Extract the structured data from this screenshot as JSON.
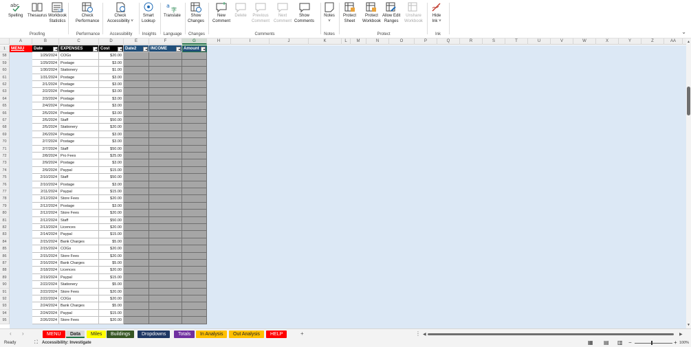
{
  "ribbon": {
    "groups": [
      {
        "label": "Proofing",
        "buttons": [
          {
            "name": "spelling",
            "label": "Spelling",
            "icon": "abc-check-icon"
          },
          {
            "name": "thesaurus",
            "label": "Thesaurus",
            "icon": "book-icon"
          },
          {
            "name": "workbook-statistics",
            "label": "Workbook\nStatistics",
            "icon": "stats-icon"
          }
        ]
      },
      {
        "label": "Performance",
        "buttons": [
          {
            "name": "check-performance",
            "label": "Check\nPerformance",
            "icon": "performance-icon"
          }
        ]
      },
      {
        "label": "Accessibility",
        "buttons": [
          {
            "name": "check-accessibility",
            "label": "Check\nAccessibility ˅",
            "icon": "accessibility-icon"
          }
        ]
      },
      {
        "label": "Insights",
        "buttons": [
          {
            "name": "smart-lookup",
            "label": "Smart\nLookup",
            "icon": "search-icon"
          }
        ]
      },
      {
        "label": "Language",
        "buttons": [
          {
            "name": "translate",
            "label": "Translate",
            "icon": "translate-icon"
          }
        ]
      },
      {
        "label": "Changes",
        "buttons": [
          {
            "name": "show-changes",
            "label": "Show\nChanges",
            "icon": "changes-icon"
          }
        ]
      },
      {
        "label": "Comments",
        "buttons": [
          {
            "name": "new-comment",
            "label": "New\nComment",
            "icon": "comment-icon"
          },
          {
            "name": "delete",
            "label": "Delete",
            "icon": "delete-comment-icon",
            "disabled": true
          },
          {
            "name": "previous-comment",
            "label": "Previous\nComment",
            "icon": "prev-comment-icon",
            "disabled": true
          },
          {
            "name": "next-comment",
            "label": "Next\nComment",
            "icon": "next-comment-icon",
            "disabled": true
          },
          {
            "name": "show-comments",
            "label": "Show\nComments",
            "icon": "comments-icon"
          }
        ]
      },
      {
        "label": "Notes",
        "buttons": [
          {
            "name": "notes",
            "label": "Notes\n˅",
            "icon": "note-icon"
          }
        ]
      },
      {
        "label": "Protect",
        "buttons": [
          {
            "name": "protect-sheet",
            "label": "Protect\nSheet",
            "icon": "protect-sheet-icon"
          },
          {
            "name": "protect-workbook",
            "label": "Protect\nWorkbook",
            "icon": "protect-workbook-icon"
          },
          {
            "name": "allow-edit-ranges",
            "label": "Allow Edit\nRanges",
            "icon": "edit-ranges-icon"
          },
          {
            "name": "unshare-workbook",
            "label": "Unshare\nWorkbook",
            "icon": "unshare-icon",
            "disabled": true
          }
        ]
      },
      {
        "label": "Ink",
        "buttons": [
          {
            "name": "hide-ink",
            "label": "Hide\nInk ˅",
            "icon": "ink-icon"
          }
        ]
      }
    ]
  },
  "columns": [
    "A",
    "B",
    "C",
    "D",
    "E",
    "F",
    "G",
    "H",
    "I",
    "J",
    "K",
    "L",
    "M",
    "N",
    "O",
    "P",
    "Q",
    "R",
    "S",
    "T",
    "U",
    "V",
    "W",
    "X",
    "Y",
    "Z",
    "AA"
  ],
  "header": {
    "row": "1",
    "menu": "MENU",
    "date": "Date",
    "expenses": "EXPENSES",
    "cost": "Cost",
    "e": "Date2",
    "f": "INCOME",
    "g": "Amount"
  },
  "rows": [
    {
      "n": "58",
      "date": "1/29/2024",
      "exp": "COGs",
      "cost": "$20.00"
    },
    {
      "n": "59",
      "date": "1/29/2024",
      "exp": "Postage",
      "cost": "$3.00"
    },
    {
      "n": "60",
      "date": "1/30/2024",
      "exp": "Stationery",
      "cost": "$1.00"
    },
    {
      "n": "61",
      "date": "1/31/2024",
      "exp": "Postage",
      "cost": "$3.00"
    },
    {
      "n": "62",
      "date": "2/1/2024",
      "exp": "Postage",
      "cost": "$3.00"
    },
    {
      "n": "63",
      "date": "2/2/2024",
      "exp": "Postage",
      "cost": "$3.00"
    },
    {
      "n": "64",
      "date": "2/3/2024",
      "exp": "Postage",
      "cost": "$3.00"
    },
    {
      "n": "65",
      "date": "2/4/2024",
      "exp": "Postage",
      "cost": "$3.00"
    },
    {
      "n": "66",
      "date": "2/5/2024",
      "exp": "Postage",
      "cost": "$3.00"
    },
    {
      "n": "67",
      "date": "2/5/2024",
      "exp": "Staff",
      "cost": "$50.00"
    },
    {
      "n": "68",
      "date": "2/5/2024",
      "exp": "Stationery",
      "cost": "$20.00"
    },
    {
      "n": "69",
      "date": "2/6/2024",
      "exp": "Postage",
      "cost": "$3.00"
    },
    {
      "n": "70",
      "date": "2/7/2024",
      "exp": "Postage",
      "cost": "$3.00"
    },
    {
      "n": "71",
      "date": "2/7/2024",
      "exp": "Staff",
      "cost": "$50.00"
    },
    {
      "n": "72",
      "date": "2/8/2024",
      "exp": "Pro Fees",
      "cost": "$25.00"
    },
    {
      "n": "73",
      "date": "2/9/2024",
      "exp": "Postage",
      "cost": "$3.00"
    },
    {
      "n": "74",
      "date": "2/9/2024",
      "exp": "Paypal",
      "cost": "$15.00"
    },
    {
      "n": "75",
      "date": "2/10/2024",
      "exp": "Staff",
      "cost": "$50.00"
    },
    {
      "n": "76",
      "date": "2/10/2024",
      "exp": "Postage",
      "cost": "$3.00"
    },
    {
      "n": "77",
      "date": "2/11/2024",
      "exp": "Paypal",
      "cost": "$15.00"
    },
    {
      "n": "78",
      "date": "2/12/2024",
      "exp": "Store Fees",
      "cost": "$20.00"
    },
    {
      "n": "79",
      "date": "2/12/2024",
      "exp": "Postage",
      "cost": "$3.00"
    },
    {
      "n": "80",
      "date": "2/12/2024",
      "exp": "Store Fees",
      "cost": "$20.00"
    },
    {
      "n": "81",
      "date": "2/12/2024",
      "exp": "Staff",
      "cost": "$50.00"
    },
    {
      "n": "82",
      "date": "2/13/2024",
      "exp": "Licences",
      "cost": "$20.00"
    },
    {
      "n": "83",
      "date": "2/14/2024",
      "exp": "Paypal",
      "cost": "$15.00"
    },
    {
      "n": "84",
      "date": "2/15/2024",
      "exp": "Bank Charges",
      "cost": "$5.00"
    },
    {
      "n": "85",
      "date": "2/15/2024",
      "exp": "COGs",
      "cost": "$20.00"
    },
    {
      "n": "86",
      "date": "2/15/2024",
      "exp": "Store Fees",
      "cost": "$20.00"
    },
    {
      "n": "87",
      "date": "2/16/2024",
      "exp": "Bank Charges",
      "cost": "$5.00"
    },
    {
      "n": "88",
      "date": "2/18/2024",
      "exp": "Licences",
      "cost": "$20.00"
    },
    {
      "n": "89",
      "date": "2/19/2024",
      "exp": "Paypal",
      "cost": "$15.00"
    },
    {
      "n": "90",
      "date": "2/22/2024",
      "exp": "Stationery",
      "cost": "$5.00"
    },
    {
      "n": "91",
      "date": "2/22/2024",
      "exp": "Store Fees",
      "cost": "$20.00"
    },
    {
      "n": "92",
      "date": "2/22/2024",
      "exp": "COGs",
      "cost": "$20.00"
    },
    {
      "n": "93",
      "date": "2/24/2024",
      "exp": "Bank Charges",
      "cost": "$5.00"
    },
    {
      "n": "94",
      "date": "2/24/2024",
      "exp": "Paypal",
      "cost": "$15.00"
    },
    {
      "n": "95",
      "date": "2/26/2024",
      "exp": "Store Fees",
      "cost": "$20.00"
    }
  ],
  "tabs": [
    {
      "label": "MENU",
      "bg": "#ff0000",
      "fg": "#ffffff"
    },
    {
      "label": "Data",
      "bg": "#d9d9d9",
      "fg": "#222222",
      "active": true
    },
    {
      "label": "Miles",
      "bg": "#ffff00",
      "fg": "#222222"
    },
    {
      "label": "Buildings",
      "bg": "#375623",
      "fg": "#ffffff"
    },
    {
      "label": "Dropdowns",
      "bg": "#1f3864",
      "fg": "#ffffff"
    },
    {
      "label": "Totals",
      "bg": "#7030a0",
      "fg": "#ffffff"
    },
    {
      "label": "In Analysis",
      "bg": "#ffc000",
      "fg": "#222222"
    },
    {
      "label": "Out Analysis",
      "bg": "#ffc000",
      "fg": "#222222"
    },
    {
      "label": "HELP",
      "bg": "#ff0000",
      "fg": "#ffffff"
    }
  ],
  "tabs_add": "+",
  "status": {
    "ready": "Ready",
    "accessibility": "Accessibility: Investigate",
    "zoom": "100%"
  }
}
